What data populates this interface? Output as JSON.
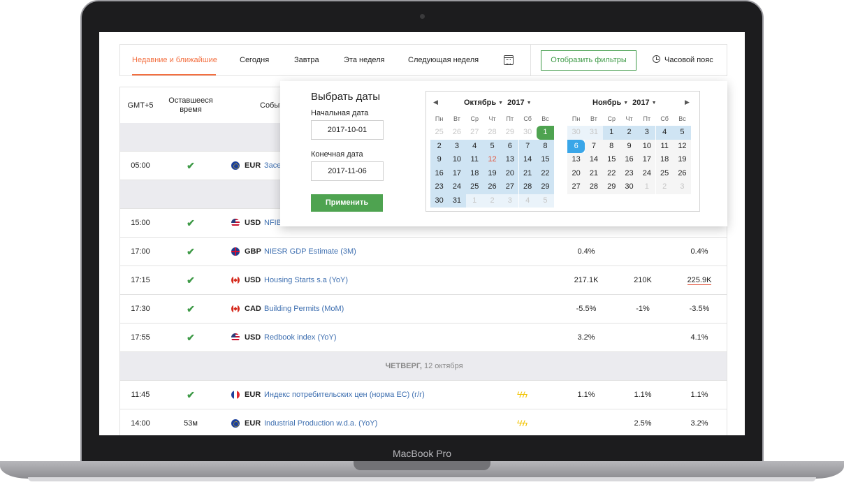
{
  "laptop": {
    "brand": "MacBook Pro"
  },
  "tabs": [
    {
      "label": "Недавние и ближайшие",
      "active": true
    },
    {
      "label": "Сегодня"
    },
    {
      "label": "Завтра"
    },
    {
      "label": "Эта неделя"
    },
    {
      "label": "Следующая неделя"
    }
  ],
  "toolbar": {
    "calendar_icon": "calendar-icon",
    "filters_label": "Отобразить фильтры",
    "timezone_label": "Часовой пояс"
  },
  "table": {
    "headers": {
      "gmt": "GMT+5",
      "remaining": "Оставшееся время",
      "event": "Событ"
    },
    "rows": [
      {
        "type": "sep"
      },
      {
        "time": "05:00",
        "left": "✔",
        "cur": "EUR",
        "ev": "Засе",
        "flag": "eu",
        "act": "",
        "fc": "",
        "prev": ""
      },
      {
        "type": "sep"
      },
      {
        "time": "15:00",
        "left": "✔",
        "cur": "USD",
        "ev": "NFIB",
        "flag": "us",
        "act": "",
        "fc": "",
        "prev": ""
      },
      {
        "time": "17:00",
        "left": "✔",
        "cur": "GBP",
        "ev": "NIESR GDP Estimate (3M)",
        "flag": "gb",
        "act": "0.4%",
        "fc": "",
        "prev": "0.4%"
      },
      {
        "time": "17:15",
        "left": "✔",
        "cur": "USD",
        "ev": "Housing Starts s.a (YoY)",
        "flag": "ca",
        "act": "217.1K",
        "fc": "210K",
        "prev": "225.9K",
        "prev_underline": true
      },
      {
        "time": "17:30",
        "left": "✔",
        "cur": "CAD",
        "ev": "Building Permits (MoM)",
        "flag": "ca",
        "act": "-5.5%",
        "fc": "-1%",
        "prev": "-3.5%"
      },
      {
        "time": "17:55",
        "left": "✔",
        "cur": "USD",
        "ev": "Redbook index (YoY)",
        "flag": "us",
        "act": "3.2%",
        "fc": "",
        "prev": "4.1%"
      },
      {
        "type": "sep",
        "day": "ЧЕТВЕРГ,",
        "date": "12 октября"
      },
      {
        "time": "11:45",
        "left": "✔",
        "cur": "EUR",
        "ev": "Индекс потребительских цен (норма ЕС) (г/г)",
        "flag": "fr",
        "imp": "ϟϟϟ",
        "act": "1.1%",
        "fc": "1.1%",
        "prev": "1.1%"
      },
      {
        "time": "14:00",
        "left": "53м",
        "cur": "EUR",
        "ev": "Industrial Production w.d.a. (YoY)",
        "flag": "eu",
        "imp": "ϟϟϟ",
        "act": "",
        "fc": "2.5%",
        "prev": "3.2%"
      }
    ]
  },
  "datepicker": {
    "title": "Выбрать даты",
    "start_label": "Начальная дата",
    "start_value": "2017-10-01",
    "end_label": "Конечная дата",
    "end_value": "2017-11-06",
    "apply_label": "Применить",
    "weekdays": [
      "Пн",
      "Вт",
      "Ср",
      "Чт",
      "Пт",
      "Сб",
      "Вс"
    ],
    "months": [
      {
        "month": "Октябрь",
        "year": "2017",
        "days": [
          "25",
          "26",
          "27",
          "28",
          "29",
          "30",
          "1",
          "2",
          "3",
          "4",
          "5",
          "6",
          "7",
          "8",
          "9",
          "10",
          "11",
          "12",
          "13",
          "14",
          "15",
          "16",
          "17",
          "18",
          "19",
          "20",
          "21",
          "22",
          "23",
          "24",
          "25",
          "26",
          "27",
          "28",
          "29",
          "30",
          "31",
          "1",
          "2",
          "3",
          "4",
          "5"
        ],
        "first_in": 6,
        "last_in": 36,
        "today": 17,
        "start": 6
      },
      {
        "month": "Ноябрь",
        "year": "2017",
        "days": [
          "30",
          "31",
          "1",
          "2",
          "3",
          "4",
          "5",
          "6",
          "7",
          "8",
          "9",
          "10",
          "11",
          "12",
          "13",
          "14",
          "15",
          "16",
          "17",
          "18",
          "19",
          "20",
          "21",
          "22",
          "23",
          "24",
          "25",
          "26",
          "27",
          "28",
          "29",
          "30",
          "1",
          "2",
          "3"
        ],
        "first_in": 2,
        "last_in": 31,
        "end": 7
      }
    ]
  }
}
